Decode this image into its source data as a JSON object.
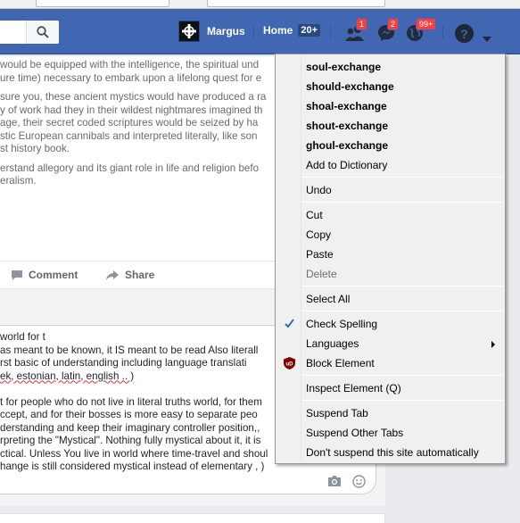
{
  "browser": {
    "chrome": ""
  },
  "header": {
    "profile_name": "Margus",
    "home_label": "Home",
    "home_count": "20+",
    "friends_badge": "1",
    "messages_badge": "2",
    "notifications_badge": "99+",
    "help_label": "?",
    "colors": {
      "bar": "#4267b2",
      "badge": "#fa3e3e"
    }
  },
  "post": {
    "lines": [
      " would be equipped with the intelligence, the spiritual und",
      "ure time) necessary to embark upon a lifelong quest for e",
      "sure you, these ancient mystics would have produced a ra",
      "y of work had they in their wildest nightmares imagined th",
      " age, their secret coded scriptures would be seized by ha",
      "stic European cannibals and interpreted literally, like son",
      "st history book.",
      "erstand allegory and its giant role in life and religion befo",
      "eralism."
    ],
    "actions": {
      "comment": "Comment",
      "share": "Share"
    }
  },
  "comment": {
    "lines": [
      "world for t",
      "as meant to be known, it IS meant to be read Also literall",
      "rst basic of understanding including    language translati",
      "ek, estonian, latin, english .. )",
      "",
      "t for people who do not live in literal truths world, for them",
      "ccept, and for their bosses  is more easy to separate peo",
      "derstanding and keep their imaginary controller position,, ",
      "rpreting the \"Mystical\".  Nothing fully mystical about it, it is",
      "ctical. Unless You live in world where time-travel and shoul",
      "hange is still considered mystical instead of elementary ,  )"
    ]
  },
  "context_menu": {
    "suggestions": [
      "soul-exchange",
      "should-exchange",
      "shoal-exchange",
      "shout-exchange",
      "ghoul-exchange"
    ],
    "add_to_dictionary": "Add to Dictionary",
    "undo": "Undo",
    "cut": "Cut",
    "copy": "Copy",
    "paste": "Paste",
    "delete": "Delete",
    "select_all": "Select All",
    "check_spelling": "Check Spelling",
    "languages": "Languages",
    "block_element": "Block Element",
    "inspect_element": "Inspect Element (Q)",
    "suspend_tab": "Suspend Tab",
    "suspend_other_tabs": "Suspend Other Tabs",
    "dont_suspend": "Don't suspend this site automatically",
    "icons": {
      "check": "check-icon",
      "ublock": "ublock-icon",
      "submenu": "submenu-arrow-icon"
    }
  }
}
